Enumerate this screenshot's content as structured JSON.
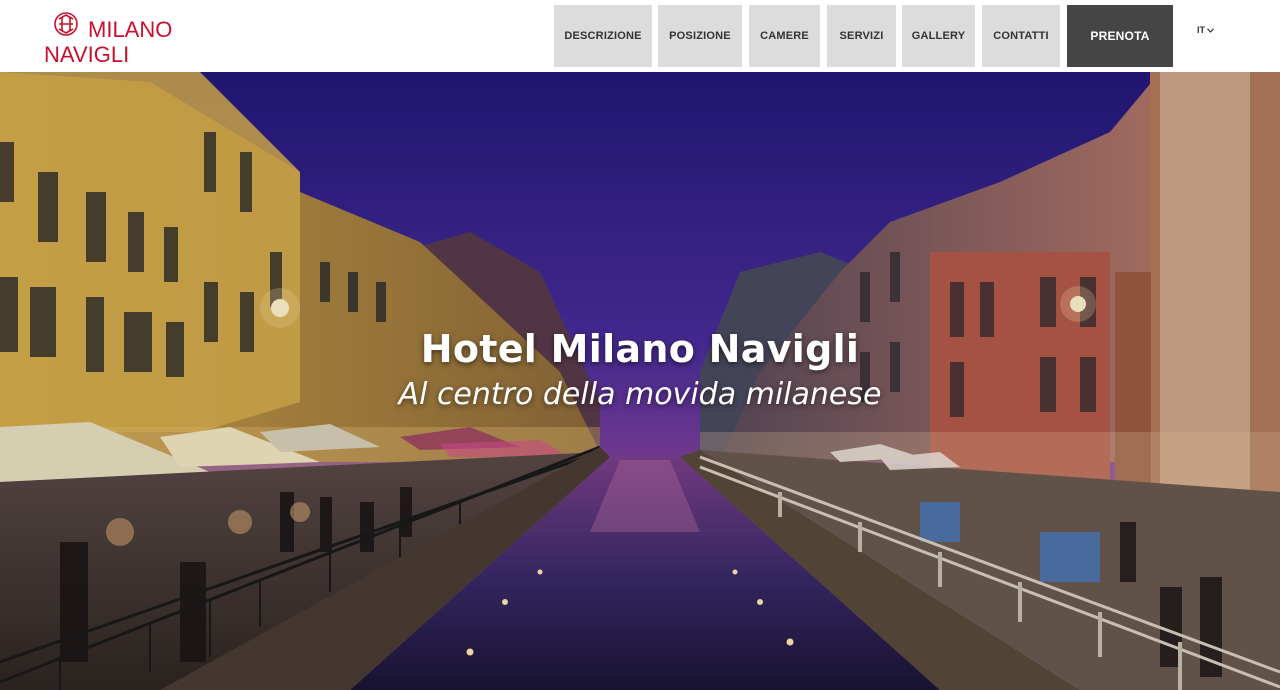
{
  "brand": {
    "logo_line1": "MILANO",
    "logo_line2": "NAVIGLI",
    "color": "#c8102e"
  },
  "nav": {
    "items": [
      {
        "label": "DESCRIZIONE"
      },
      {
        "label": "POSIZIONE"
      },
      {
        "label": "CAMERE"
      },
      {
        "label": "SERVIZI"
      },
      {
        "label": "GALLERY"
      },
      {
        "label": "CONTATTI"
      }
    ],
    "book_label": "PRENOTA",
    "language": "IT"
  },
  "hero": {
    "title": "Hotel Milano Navigli",
    "subtitle": "Al centro della movida milanese"
  },
  "colors": {
    "nav_bg": "#dcdcdc",
    "book_bg": "#454545",
    "sky_top": "#2a1e7a",
    "sky_bottom": "#b84a8a"
  }
}
